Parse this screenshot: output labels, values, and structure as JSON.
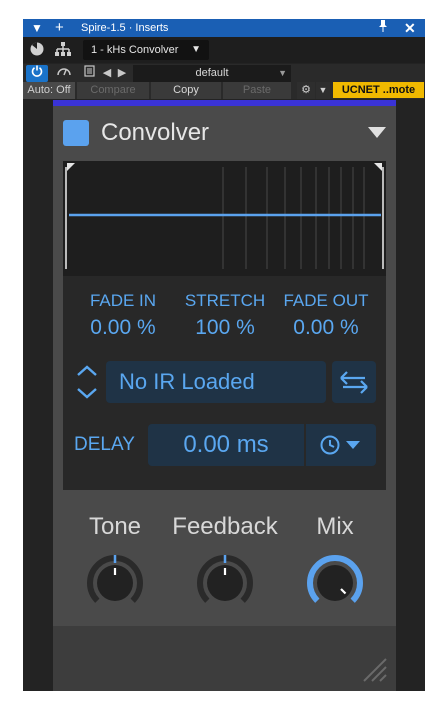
{
  "window": {
    "title": "Spire-1.5 · Inserts",
    "icons": [
      "menu-triangle-icon",
      "add-icon",
      "pin-icon",
      "close-icon"
    ]
  },
  "toolbar1": {
    "insert_select": "1 - kHs Convolver"
  },
  "toolbar2": {
    "preset_name": "default"
  },
  "toolbar3": {
    "auto_label": "Auto: Off",
    "compare_label": "Compare",
    "copy_label": "Copy",
    "paste_label": "Paste",
    "remote_label": "UCNET ..mote"
  },
  "plugin": {
    "title": "Convolver",
    "accent": "#5ba2ee",
    "fade_in_label": "FADE IN",
    "fade_in_value": "0.00 %",
    "stretch_label": "STRETCH",
    "stretch_value": "100 %",
    "fade_out_label": "FADE OUT",
    "fade_out_value": "0.00 %",
    "ir_name": "No IR Loaded",
    "delay_label": "DELAY",
    "delay_value": "0.00 ms",
    "knobs": [
      {
        "label": "Tone",
        "fraction": 0.5
      },
      {
        "label": "Feedback",
        "fraction": 0.5
      },
      {
        "label": "Mix",
        "fraction": 1.0
      }
    ]
  },
  "colors": {
    "titlebar": "#1a5fb4",
    "accent_text": "#5aa7f0",
    "purple_strip": "#3a33d6",
    "remote_button": "#f0b900"
  }
}
